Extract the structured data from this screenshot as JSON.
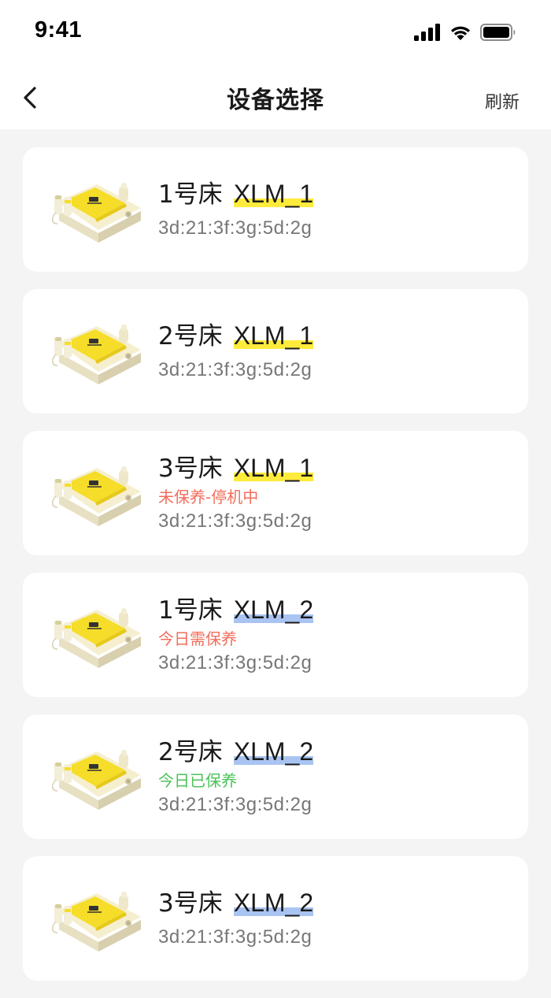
{
  "status_bar": {
    "time": "9:41",
    "icons": [
      "signal-icon",
      "wifi-icon",
      "battery-icon"
    ]
  },
  "nav": {
    "back_icon": "chevron-left-icon",
    "title": "设备选择",
    "refresh_label": "刷新"
  },
  "colors": {
    "highlight_xlm1": "#ffeb3b",
    "highlight_xlm2": "#a9c4f2",
    "status_warning": "#f26d5b",
    "status_ok": "#4cc25a",
    "mac_text": "#777777"
  },
  "devices": [
    {
      "bed": "1号床",
      "model": "XLM_1",
      "highlight": "#ffeb3b",
      "status": "",
      "status_color": "",
      "mac": "3d:21:3f:3g:5d:2g"
    },
    {
      "bed": "2号床",
      "model": "XLM_1",
      "highlight": "#ffeb3b",
      "status": "",
      "status_color": "",
      "mac": "3d:21:3f:3g:5d:2g"
    },
    {
      "bed": "3号床",
      "model": "XLM_1",
      "highlight": "#ffeb3b",
      "status": "未保养-停机中",
      "status_color": "#f26d5b",
      "mac": "3d:21:3f:3g:5d:2g"
    },
    {
      "bed": "1号床",
      "model": "XLM_2",
      "highlight": "#a9c4f2",
      "status": "今日需保养",
      "status_color": "#f26d5b",
      "mac": "3d:21:3f:3g:5d:2g"
    },
    {
      "bed": "2号床",
      "model": "XLM_2",
      "highlight": "#a9c4f2",
      "status": "今日已保养",
      "status_color": "#4cc25a",
      "mac": "3d:21:3f:3g:5d:2g"
    },
    {
      "bed": "3号床",
      "model": "XLM_2",
      "highlight": "#a9c4f2",
      "status": "",
      "status_color": "",
      "mac": "3d:21:3f:3g:5d:2g"
    }
  ]
}
